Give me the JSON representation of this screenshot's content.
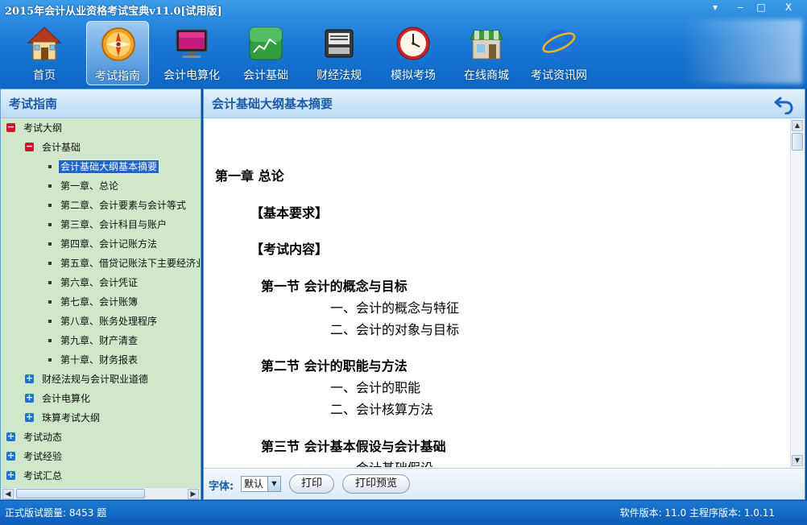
{
  "window": {
    "title": "2015年会计从业资格考试宝典v11.0[试用版]",
    "controls": [
      "▾",
      "‒",
      "□",
      "X"
    ]
  },
  "toolbar": {
    "items": [
      {
        "label": "首页",
        "icon": "house-icon"
      },
      {
        "label": "考试指南",
        "icon": "compass-icon",
        "active": true
      },
      {
        "label": "会计电算化",
        "icon": "monitor-icon"
      },
      {
        "label": "会计基础",
        "icon": "chart-board-icon"
      },
      {
        "label": "财经法规",
        "icon": "printer-icon"
      },
      {
        "label": "模拟考场",
        "icon": "clock-icon"
      },
      {
        "label": "在线商城",
        "icon": "shop-icon"
      },
      {
        "label": "考试资讯网",
        "icon": "ie-browser-icon"
      }
    ]
  },
  "sidebar": {
    "title": "考试指南",
    "tree": [
      {
        "label": "考试大纲",
        "level": 0,
        "state": "minus"
      },
      {
        "label": "会计基础",
        "level": 1,
        "state": "minus"
      },
      {
        "label": "会计基础大纲基本摘要",
        "level": 2,
        "state": "leaf",
        "selected": true
      },
      {
        "label": "第一章、总论",
        "level": 2,
        "state": "leaf"
      },
      {
        "label": "第二章、会计要素与会计等式",
        "level": 2,
        "state": "leaf"
      },
      {
        "label": "第三章、会计科目与账户",
        "level": 2,
        "state": "leaf"
      },
      {
        "label": "第四章、会计记账方法",
        "level": 2,
        "state": "leaf"
      },
      {
        "label": "第五章、借贷记账法下主要经济业",
        "level": 2,
        "state": "leaf"
      },
      {
        "label": "第六章、会计凭证",
        "level": 2,
        "state": "leaf"
      },
      {
        "label": "第七章、会计账簿",
        "level": 2,
        "state": "leaf"
      },
      {
        "label": "第八章、账务处理程序",
        "level": 2,
        "state": "leaf"
      },
      {
        "label": "第九章、财产清查",
        "level": 2,
        "state": "leaf"
      },
      {
        "label": "第十章、财务报表",
        "level": 2,
        "state": "leaf"
      },
      {
        "label": "财经法规与会计职业道德",
        "level": 1,
        "state": "plus"
      },
      {
        "label": "会计电算化",
        "level": 1,
        "state": "plus"
      },
      {
        "label": "珠算考试大纲",
        "level": 1,
        "state": "plus"
      },
      {
        "label": "考试动态",
        "level": 0,
        "state": "plus"
      },
      {
        "label": "考试经验",
        "level": 0,
        "state": "plus"
      },
      {
        "label": "考试汇总",
        "level": 0,
        "state": "plus"
      }
    ]
  },
  "content": {
    "title": "会计基础大纲基本摘要",
    "lines": [
      {
        "text": "第一章   总论",
        "kind": "chapter"
      },
      {
        "text": "【基本要求】",
        "kind": "section"
      },
      {
        "text": "【考试内容】",
        "kind": "section"
      },
      {
        "text": "第一节   会计的概念与目标",
        "kind": "node"
      },
      {
        "text": "一、会计的概念与特征",
        "kind": "item"
      },
      {
        "text": "二、会计的对象与目标",
        "kind": "item"
      },
      {
        "text": "第二节   会计的职能与方法",
        "kind": "node"
      },
      {
        "text": "一、会计的职能",
        "kind": "item"
      },
      {
        "text": "二、会计核算方法",
        "kind": "item"
      },
      {
        "text": "第三节   会计基本假设与会计基础",
        "kind": "node"
      },
      {
        "text": "一、会计基础假设",
        "kind": "item"
      }
    ],
    "font_label": "字体:",
    "font_value": "默认",
    "print_label": "打印",
    "preview_label": "打印预览"
  },
  "status": {
    "left": "正式版试题量: 8453 题",
    "right": "软件版本: 11.0 主程序版本: 1.0.11"
  }
}
